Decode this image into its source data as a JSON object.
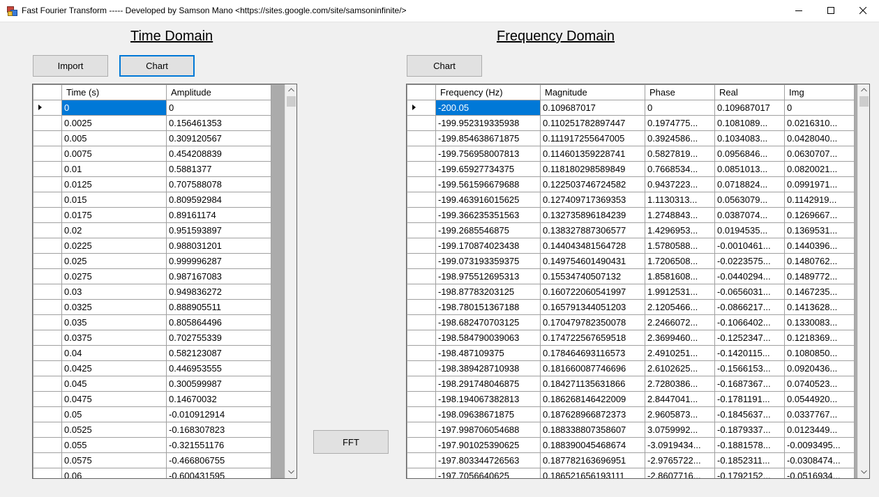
{
  "window": {
    "title": "Fast Fourier Transform ----- Developed by Samson Mano <https://sites.google.com/site/samsoninfinite/>"
  },
  "time_domain": {
    "heading": "Time Domain",
    "import_label": "Import",
    "chart_label": "Chart",
    "columns": [
      "Time (s)",
      "Amplitude"
    ],
    "rows": [
      [
        "0",
        "0"
      ],
      [
        "0.0025",
        "0.156461353"
      ],
      [
        "0.005",
        "0.309120567"
      ],
      [
        "0.0075",
        "0.454208839"
      ],
      [
        "0.01",
        "0.5881377"
      ],
      [
        "0.0125",
        "0.707588078"
      ],
      [
        "0.015",
        "0.809592984"
      ],
      [
        "0.0175",
        "0.89161174"
      ],
      [
        "0.02",
        "0.951593897"
      ],
      [
        "0.0225",
        "0.988031201"
      ],
      [
        "0.025",
        "0.999996287"
      ],
      [
        "0.0275",
        "0.987167083"
      ],
      [
        "0.03",
        "0.949836272"
      ],
      [
        "0.0325",
        "0.888905511"
      ],
      [
        "0.035",
        "0.805864496"
      ],
      [
        "0.0375",
        "0.702755339"
      ],
      [
        "0.04",
        "0.582123087"
      ],
      [
        "0.0425",
        "0.446953555"
      ],
      [
        "0.045",
        "0.300599987"
      ],
      [
        "0.0475",
        "0.14670032"
      ],
      [
        "0.05",
        "-0.010912914"
      ],
      [
        "0.0525",
        "-0.168307823"
      ],
      [
        "0.055",
        "-0.321551176"
      ],
      [
        "0.0575",
        "-0.466806755"
      ],
      [
        "0.06",
        "-0.600431595"
      ]
    ]
  },
  "fft_label": "FFT",
  "frequency_domain": {
    "heading": "Frequency Domain",
    "chart_label": "Chart",
    "columns": [
      "Frequency (Hz)",
      "Magnitude",
      "Phase",
      "Real",
      "Img"
    ],
    "rows": [
      [
        "-200.05",
        "0.109687017",
        "0",
        "0.109687017",
        "0"
      ],
      [
        "-199.952319335938",
        "0.110251782897447",
        "0.1974775...",
        "0.1081089...",
        "0.0216310..."
      ],
      [
        "-199.854638671875",
        "0.111917255647005",
        "0.3924586...",
        "0.1034083...",
        "0.0428040..."
      ],
      [
        "-199.756958007813",
        "0.114601359228741",
        "0.5827819...",
        "0.0956846...",
        "0.0630707..."
      ],
      [
        "-199.65927734375",
        "0.118180298589849",
        "0.7668534...",
        "0.0851013...",
        "0.0820021..."
      ],
      [
        "-199.561596679688",
        "0.122503746724582",
        "0.9437223...",
        "0.0718824...",
        "0.0991971..."
      ],
      [
        "-199.463916015625",
        "0.127409717369353",
        "1.1130313...",
        "0.0563079...",
        "0.1142919..."
      ],
      [
        "-199.366235351563",
        "0.132735896184239",
        "1.2748843...",
        "0.0387074...",
        "0.1269667..."
      ],
      [
        "-199.2685546875",
        "0.138327887306577",
        "1.4296953...",
        "0.0194535...",
        "0.1369531..."
      ],
      [
        "-199.170874023438",
        "0.144043481564728",
        "1.5780588...",
        "-0.0010461...",
        "0.1440396..."
      ],
      [
        "-199.073193359375",
        "0.149754601490431",
        "1.7206508...",
        "-0.0223575...",
        "0.1480762..."
      ],
      [
        "-198.975512695313",
        "0.15534740507132",
        "1.8581608...",
        "-0.0440294...",
        "0.1489772..."
      ],
      [
        "-198.87783203125",
        "0.160722060541997",
        "1.9912531...",
        "-0.0656031...",
        "0.1467235..."
      ],
      [
        "-198.780151367188",
        "0.165791344051203",
        "2.1205466...",
        "-0.0866217...",
        "0.1413628..."
      ],
      [
        "-198.682470703125",
        "0.170479782350078",
        "2.2466072...",
        "-0.1066402...",
        "0.1330083..."
      ],
      [
        "-198.584790039063",
        "0.174722567659518",
        "2.3699460...",
        "-0.1252347...",
        "0.1218369..."
      ],
      [
        "-198.487109375",
        "0.178464693116573",
        "2.4910251...",
        "-0.1420115...",
        "0.1080850..."
      ],
      [
        "-198.389428710938",
        "0.181660087746696",
        "2.6102625...",
        "-0.1566153...",
        "0.0920436..."
      ],
      [
        "-198.291748046875",
        "0.184271135631866",
        "2.7280386...",
        "-0.1687367...",
        "0.0740523..."
      ],
      [
        "-198.194067382813",
        "0.186268146422009",
        "2.8447041...",
        "-0.1781191...",
        "0.0544920..."
      ],
      [
        "-198.09638671875",
        "0.187628966872373",
        "2.9605873...",
        "-0.1845637...",
        "0.0337767..."
      ],
      [
        "-197.998706054688",
        "0.188338807358607",
        "3.0759992...",
        "-0.1879337...",
        "0.0123449..."
      ],
      [
        "-197.901025390625",
        "0.188390045468674",
        "-3.0919434...",
        "-0.1881578...",
        "-0.0093495..."
      ],
      [
        "-197.803344726563",
        "0.187782163696951",
        "-2.9765722...",
        "-0.1852311...",
        "-0.0308474..."
      ],
      [
        "-197.7056640625",
        "0.186521656193111",
        "-2.8607716...",
        "-0.1792152...",
        "-0.0516934..."
      ]
    ]
  }
}
